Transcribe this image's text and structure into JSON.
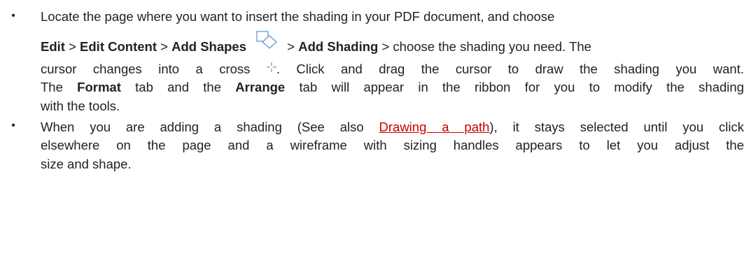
{
  "bullet_char": "•",
  "item1": {
    "line1": "Locate the page where you want to insert the shading in your PDF document, and choose",
    "menu_edit": "Edit",
    "sep1": " > ",
    "menu_edit_content": "Edit Content",
    "sep2": " > ",
    "menu_add_shapes": "Add Shapes",
    "sep3": " > ",
    "menu_add_shading": "Add Shading",
    "after_add_shading": " > choose the shading you need. The",
    "line3_before_icon": "cursor changes into a cross ",
    "line3_after_icon": ". Click and drag the cursor to draw the shading you want.",
    "line4_before_format": "The ",
    "format_tab": "Format",
    "line4_middle": " tab and the ",
    "arrange_tab": "Arrange",
    "line4_after": " tab will appear in the ribbon for you to modify the shading",
    "line5": "with the tools."
  },
  "item2": {
    "line1_before_link": "When you are adding a shading (See also ",
    "link_text": "Drawing a path",
    "line1_after_link": "), it stays selected until you click",
    "line2": "elsewhere on the page and a wireframe with sizing handles appears to let you adjust the",
    "line3": "size and shape."
  },
  "icons": {
    "add_shapes": "add-shapes-icon",
    "cross_cursor": "cross-cursor-icon"
  },
  "colors": {
    "text": "#222222",
    "link": "#cc0000",
    "icon_stroke": "#5b8fd6"
  }
}
